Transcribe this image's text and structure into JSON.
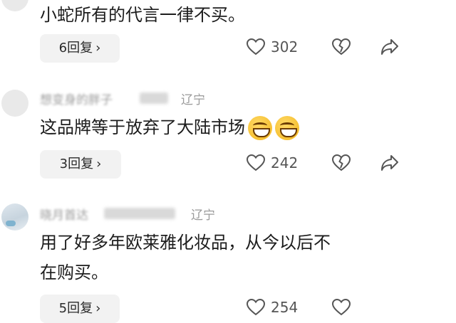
{
  "comments": [
    {
      "username": "",
      "location": "",
      "text_lines": [
        "小蛇所有的代言一律不买。"
      ],
      "reply_label": "6回复",
      "like_count": "302"
    },
    {
      "username": "想变身的胖子",
      "location": "辽宁",
      "text_lines": [
        "这品牌等于放弃了大陆市场"
      ],
      "emojis": [
        "grin-emoji",
        "grin-emoji"
      ],
      "reply_label": "3回复",
      "like_count": "242"
    },
    {
      "username": "晓月首达",
      "location": "辽宁",
      "text_lines": [
        "用了好多年欧莱雅化妆品，从今以后不",
        "在购买。"
      ],
      "reply_label": "5回复",
      "like_count": "254"
    }
  ],
  "icons": {
    "like": "heart-outline-icon",
    "dislike": "broken-heart-icon",
    "share": "share-arrow-icon",
    "chevron": "chevron-right-icon"
  },
  "colors": {
    "meta": "#9a9a9a",
    "button_bg": "#f2f2f2"
  }
}
